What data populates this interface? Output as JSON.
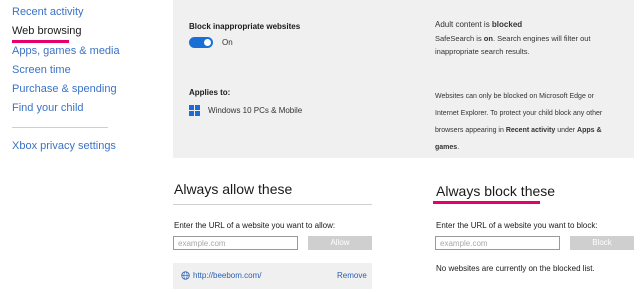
{
  "sidebar": {
    "items": [
      {
        "label": "Recent activity"
      },
      {
        "label": "Web browsing"
      },
      {
        "label": "Apps, games & media"
      },
      {
        "label": "Screen time"
      },
      {
        "label": "Purchase & spending"
      },
      {
        "label": "Find your child"
      }
    ],
    "secondary": {
      "label": "Xbox privacy settings"
    }
  },
  "panel": {
    "block_title": "Block inappropriate websites",
    "toggle_state": "On",
    "applies_title": "Applies to:",
    "device": "Windows 10 PCs & Mobile",
    "adult_prefix": "Adult content is ",
    "adult_status": "blocked",
    "safesearch_prefix": "SafeSearch is ",
    "safesearch_status": "on",
    "safesearch_line1_rest": ". Search engines will filter out",
    "safesearch_line2": "inappropriate search results.",
    "note_line1": "Websites can only be blocked on Microsoft Edge or",
    "note_line2": "Internet Explorer. To protect your child block any other",
    "note_line3_pre": "browsers appearing in ",
    "note_line3_bold1": "Recent activity",
    "note_line3_mid": " under ",
    "note_line3_bold2": "Apps  &",
    "note_line4_bold": "games",
    "note_line4_end": "."
  },
  "allow": {
    "title": "Always allow these",
    "field_label": "Enter the URL of a website you want to allow:",
    "placeholder": "example.com",
    "button": "Allow",
    "sites": [
      {
        "url": "http://beebom.com/",
        "remove": "Remove"
      }
    ]
  },
  "block": {
    "title": "Always block these",
    "field_label": "Enter the URL of a website you want to block:",
    "placeholder": "example.com",
    "button": "Block",
    "empty_text": "No websites are currently on the blocked list."
  },
  "colors": {
    "accent": "#e6006e",
    "link": "#3b72c6",
    "toggle": "#1a6fd6",
    "panel": "#f0f0f0"
  }
}
